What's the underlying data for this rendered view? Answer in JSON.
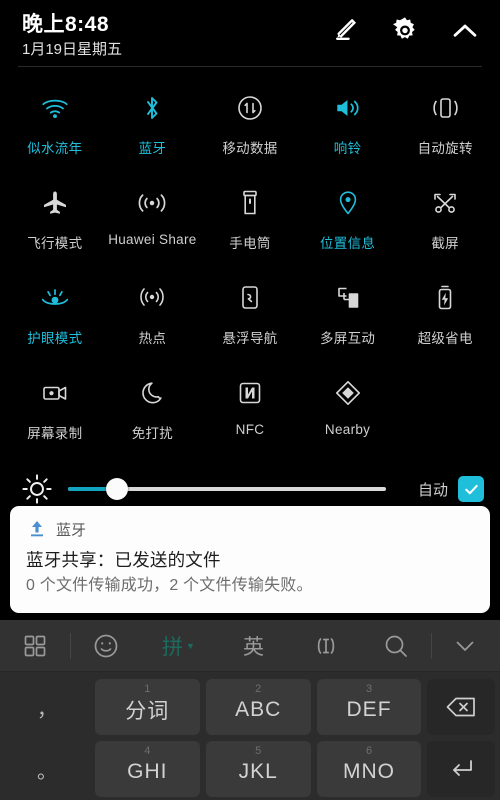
{
  "statusbar": {
    "time": "晚上8:48",
    "date": "1月19日星期五",
    "icons": [
      {
        "name": "edit-icon",
        "label": "编辑"
      },
      {
        "name": "settings-gear-icon",
        "label": "设置"
      },
      {
        "name": "chevron-up-icon",
        "label": "收起"
      }
    ]
  },
  "quick_settings": {
    "accent_on": "#1fbfdc",
    "accent_off": "#d8d8d8",
    "rows": [
      [
        {
          "label": "似水流年",
          "icon": "wifi-icon",
          "active": true
        },
        {
          "label": "蓝牙",
          "icon": "bluetooth-icon",
          "active": true
        },
        {
          "label": "移动数据",
          "icon": "mobile-data-icon",
          "active": false
        },
        {
          "label": "响铃",
          "icon": "ringer-volume-icon",
          "active": true
        },
        {
          "label": "自动旋转",
          "icon": "auto-rotate-icon",
          "active": false
        }
      ],
      [
        {
          "label": "飞行模式",
          "icon": "airplane-icon",
          "active": false
        },
        {
          "label": "Huawei Share",
          "icon": "huawei-share-icon",
          "active": false
        },
        {
          "label": "手电筒",
          "icon": "flashlight-icon",
          "active": false
        },
        {
          "label": "位置信息",
          "icon": "location-pin-icon",
          "active": true
        },
        {
          "label": "截屏",
          "icon": "screenshot-icon",
          "active": false
        }
      ],
      [
        {
          "label": "护眼模式",
          "icon": "eye-comfort-icon",
          "active": true
        },
        {
          "label": "热点",
          "icon": "hotspot-icon",
          "active": false
        },
        {
          "label": "悬浮导航",
          "icon": "floating-nav-icon",
          "active": false
        },
        {
          "label": "多屏互动",
          "icon": "multi-screen-icon",
          "active": false
        },
        {
          "label": "超级省电",
          "icon": "battery-saver-icon",
          "active": false
        }
      ],
      [
        {
          "label": "屏幕录制",
          "icon": "screen-record-icon",
          "active": false
        },
        {
          "label": "免打扰",
          "icon": "do-not-disturb-moon-icon",
          "active": false
        },
        {
          "label": "NFC",
          "icon": "nfc-icon",
          "active": false
        },
        {
          "label": "Nearby",
          "icon": "nearby-icon",
          "active": false
        },
        {
          "label": "",
          "icon": "",
          "active": false,
          "empty": true
        }
      ]
    ]
  },
  "brightness": {
    "icon": "brightness-sun-icon",
    "value_percent": 12,
    "auto_label": "自动",
    "auto_checked": true,
    "checkbox_color": "#1fbfdc",
    "fill_color": "#13a5bf"
  },
  "notification": {
    "icon": "upload-arrow-icon",
    "icon_color": "#4a8fd0",
    "app_name": "蓝牙",
    "title": "蓝牙共享：已发送的文件",
    "body": "0 个文件传输成功，2 个文件传输失败。"
  },
  "keyboard": {
    "toolbar": [
      {
        "name": "keyboard-layouts-icon",
        "label": "布局",
        "type": "icon"
      },
      {
        "name": "emoji-icon",
        "label": "表情",
        "type": "icon"
      },
      {
        "name": "pinyin-mode-button",
        "label": "拼",
        "type": "text",
        "active": true,
        "has_caret": true
      },
      {
        "name": "english-mode-button",
        "label": "英",
        "type": "text",
        "active": false
      },
      {
        "name": "cursor-move-icon",
        "label": "光标",
        "type": "icon"
      },
      {
        "name": "search-icon",
        "label": "搜索",
        "type": "icon"
      },
      {
        "name": "collapse-keyboard-icon",
        "label": "收起键盘",
        "type": "icon"
      }
    ],
    "rows": [
      [
        {
          "num": "",
          "main": "，",
          "kind": "punct",
          "name": "key-comma"
        },
        {
          "num": "1",
          "main": "分词",
          "kind": "std",
          "name": "key-1"
        },
        {
          "num": "2",
          "main": "ABC",
          "kind": "std",
          "name": "key-2"
        },
        {
          "num": "3",
          "main": "DEF",
          "kind": "std",
          "name": "key-3"
        },
        {
          "num": "",
          "main": "",
          "kind": "fn",
          "name": "key-backspace",
          "icon": "backspace-icon"
        }
      ],
      [
        {
          "num": "",
          "main": "。",
          "kind": "punct",
          "name": "key-period"
        },
        {
          "num": "4",
          "main": "GHI",
          "kind": "std",
          "name": "key-4"
        },
        {
          "num": "5",
          "main": "JKL",
          "kind": "std",
          "name": "key-5"
        },
        {
          "num": "6",
          "main": "MNO",
          "kind": "std",
          "name": "key-6"
        },
        {
          "num": "",
          "main": "",
          "kind": "fn",
          "name": "key-enter",
          "icon": "enter-icon"
        }
      ]
    ]
  }
}
